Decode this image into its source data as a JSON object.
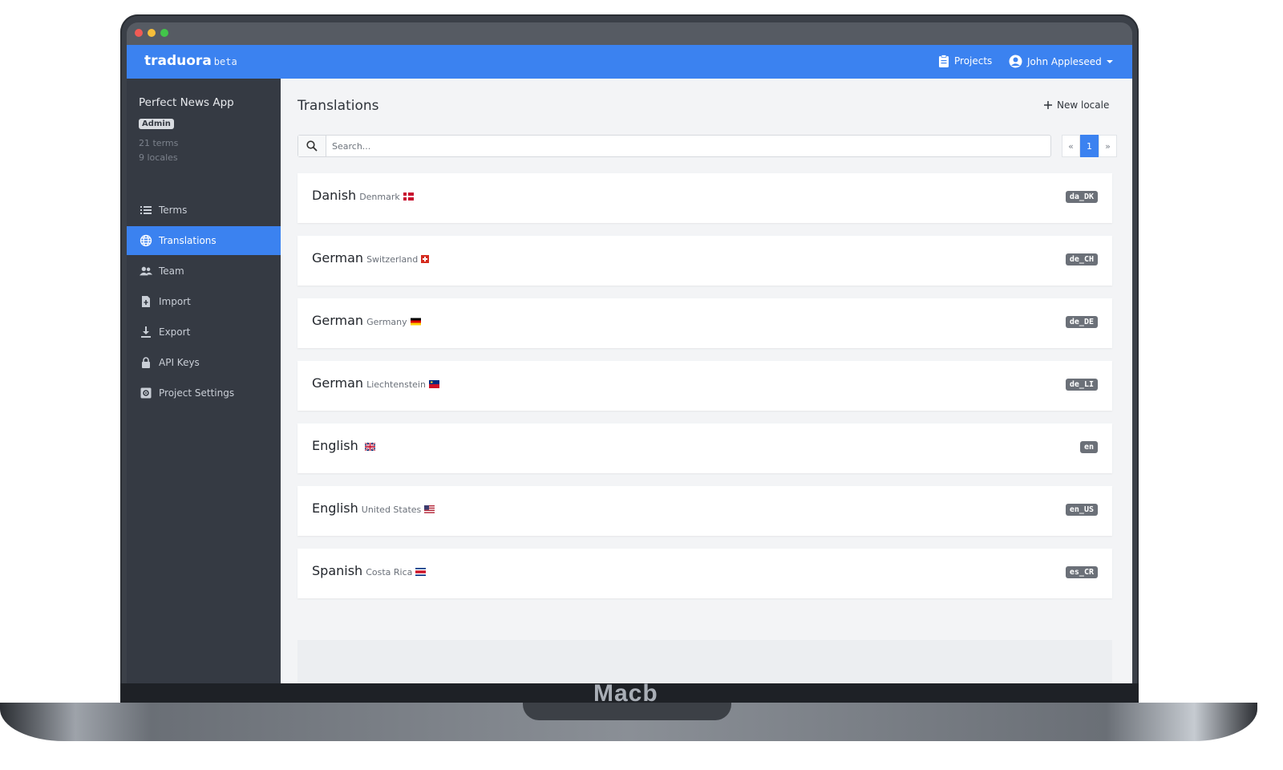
{
  "device": {
    "brand_text": "Macb"
  },
  "navbar": {
    "brand": "traduora",
    "brand_suffix": "beta",
    "projects_label": "Projects",
    "user_name": "John Appleseed"
  },
  "sidebar": {
    "project_name": "Perfect News App",
    "role_badge": "Admin",
    "terms_count": "21 terms",
    "locales_count": "9 locales",
    "items": [
      {
        "label": "Terms",
        "icon": "list-icon"
      },
      {
        "label": "Translations",
        "icon": "globe-icon",
        "active": true
      },
      {
        "label": "Team",
        "icon": "team-icon"
      },
      {
        "label": "Import",
        "icon": "file-import-icon"
      },
      {
        "label": "Export",
        "icon": "download-icon"
      },
      {
        "label": "API Keys",
        "icon": "lock-icon"
      },
      {
        "label": "Project Settings",
        "icon": "settings-icon"
      }
    ]
  },
  "main": {
    "title": "Translations",
    "new_locale_label": "New locale",
    "search": {
      "placeholder": "Search..."
    },
    "pagination": {
      "prev": "«",
      "current": "1",
      "next": "»"
    },
    "locales": [
      {
        "language": "Danish",
        "region": "Denmark",
        "code": "da_DK"
      },
      {
        "language": "German",
        "region": "Switzerland",
        "code": "de_CH"
      },
      {
        "language": "German",
        "region": "Germany",
        "code": "de_DE"
      },
      {
        "language": "German",
        "region": "Liechtenstein",
        "code": "de_LI"
      },
      {
        "language": "English",
        "region": "",
        "code": "en"
      },
      {
        "language": "English",
        "region": "United States",
        "code": "en_US"
      },
      {
        "language": "Spanish",
        "region": "Costa Rica",
        "code": "es_CR"
      }
    ]
  },
  "colors": {
    "primary": "#3b82f0",
    "sidebar_bg": "#353a43",
    "badge_bg": "#6b7078"
  }
}
